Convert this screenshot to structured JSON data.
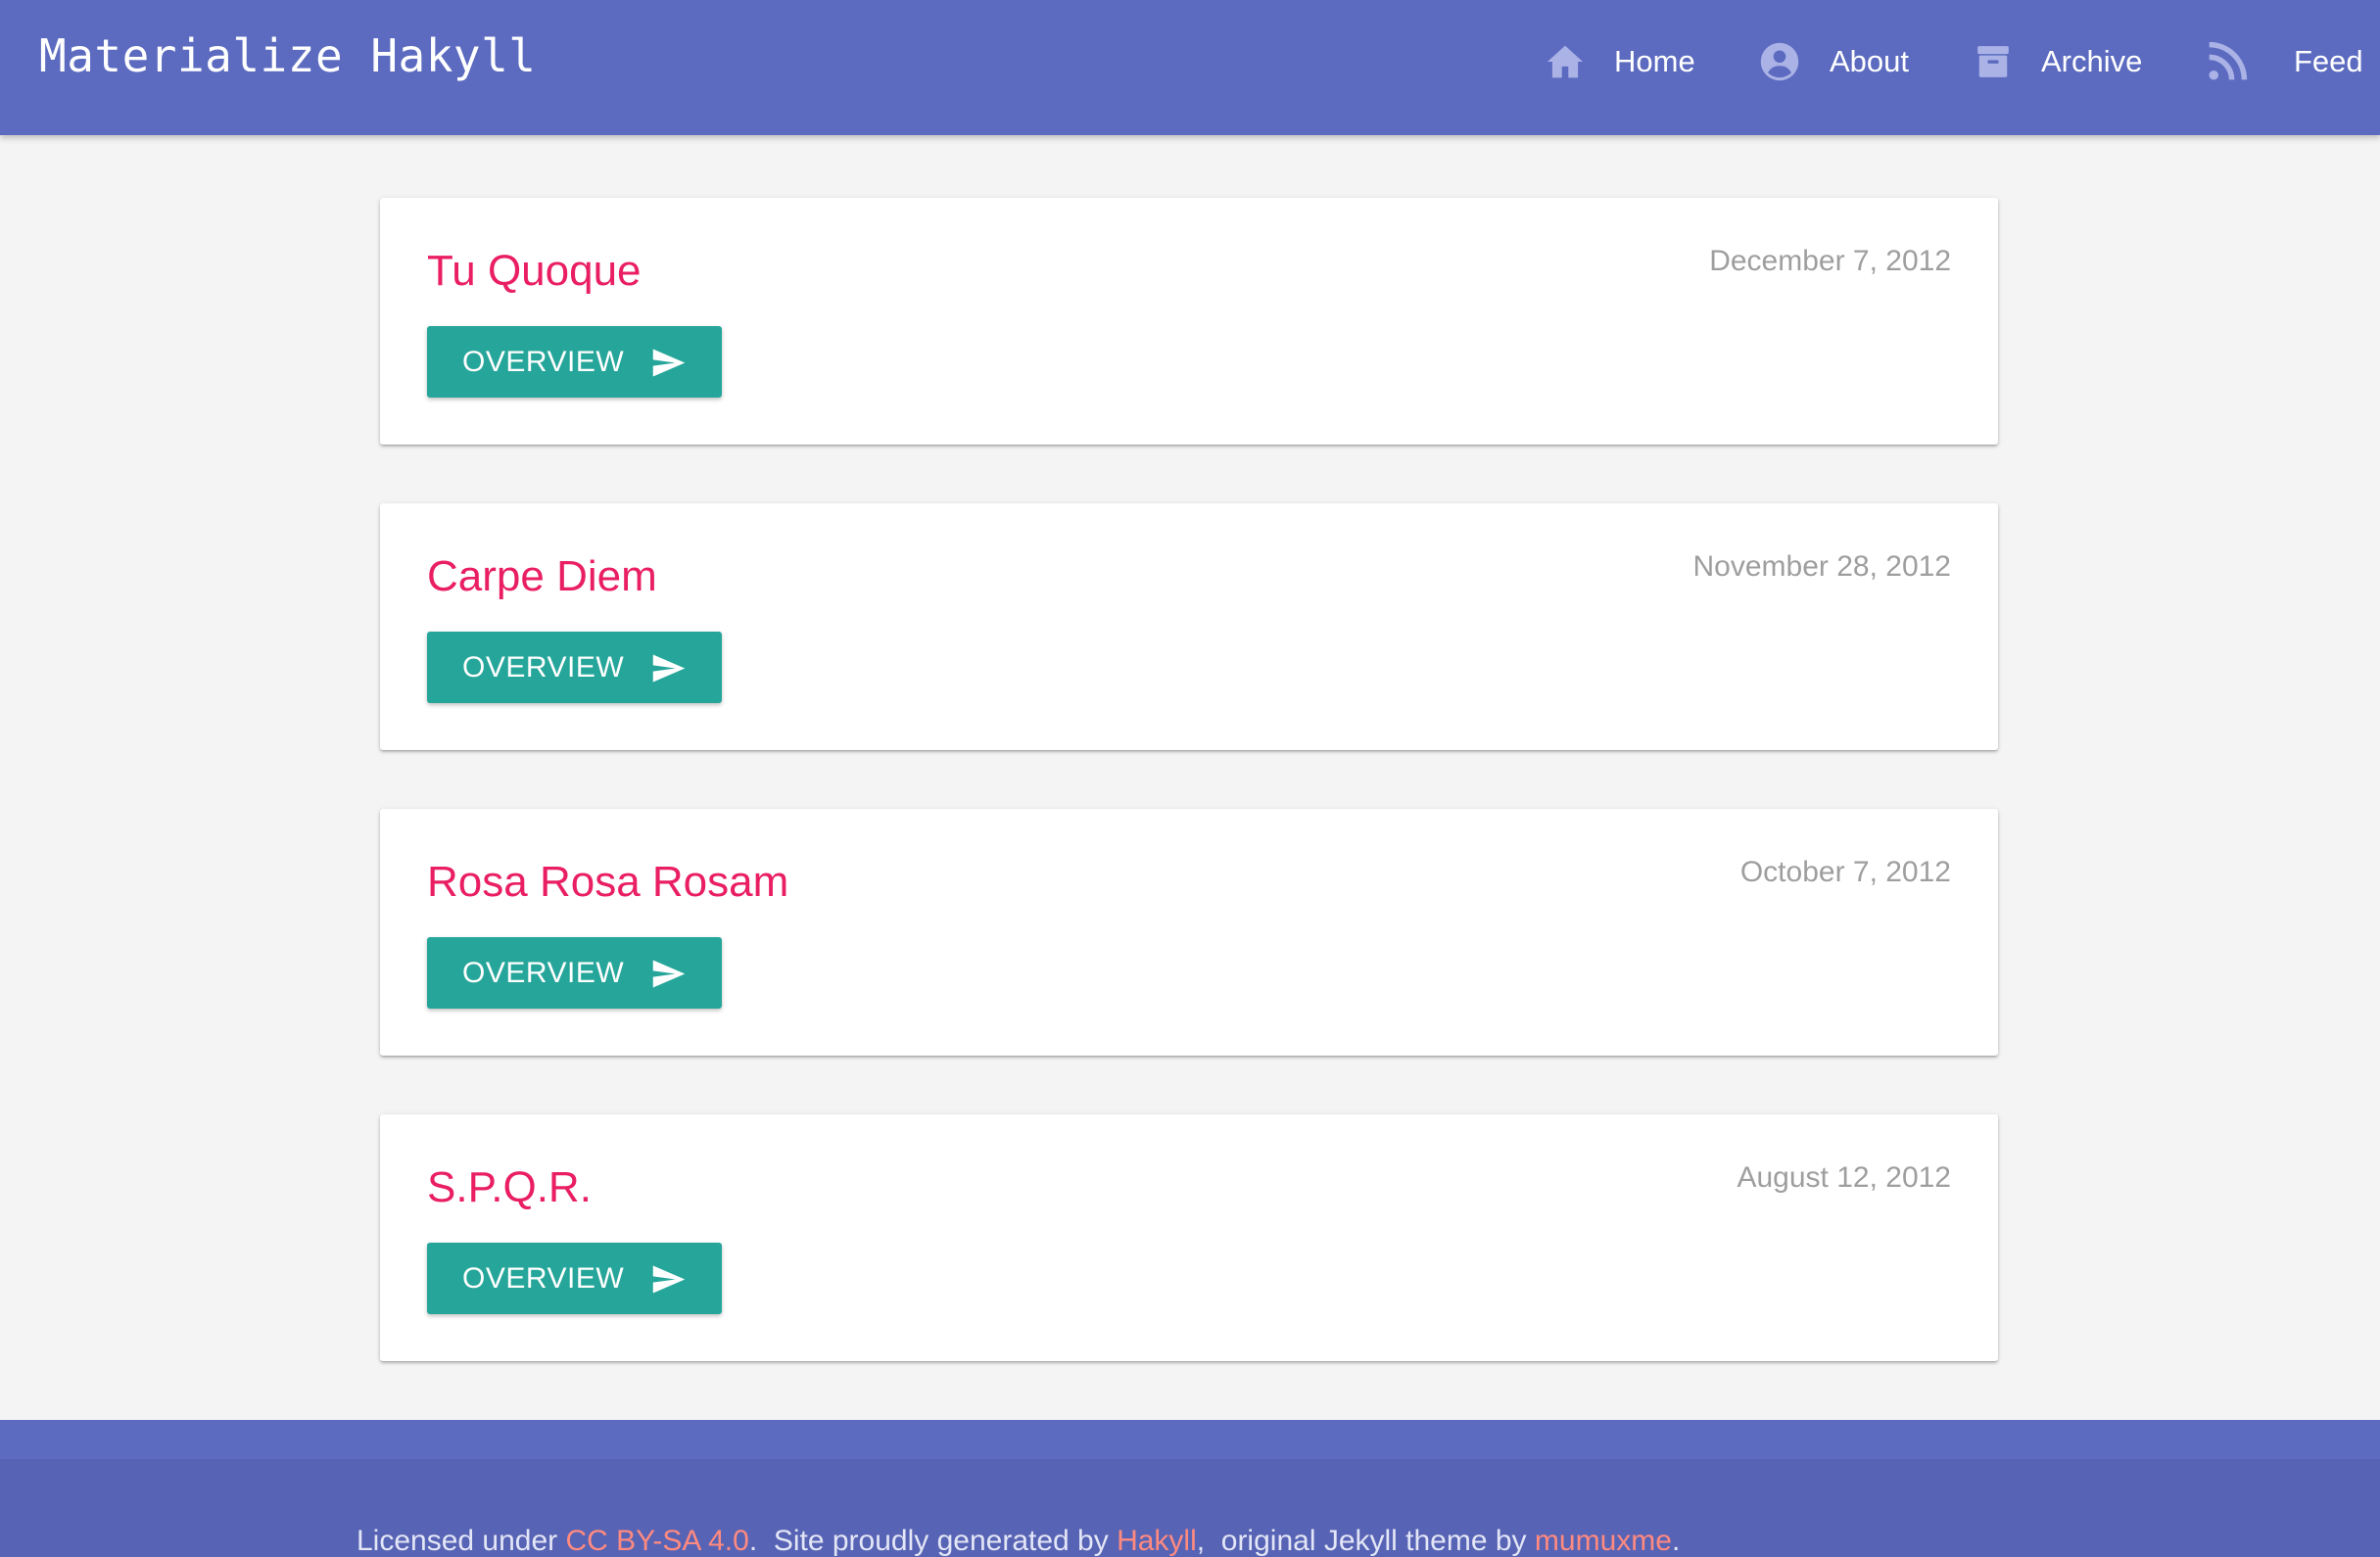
{
  "navbar": {
    "brand": "Materialize Hakyll",
    "items": [
      {
        "label": "Home",
        "icon": "home-icon"
      },
      {
        "label": "About",
        "icon": "account-circle-icon"
      },
      {
        "label": "Archive",
        "icon": "archive-icon"
      },
      {
        "label": "Feed",
        "icon": "rss-feed-icon"
      }
    ]
  },
  "posts": [
    {
      "title": "Tu Quoque",
      "date": "December 7, 2012",
      "button": "OVERVIEW"
    },
    {
      "title": "Carpe Diem",
      "date": "November 28, 2012",
      "button": "OVERVIEW"
    },
    {
      "title": "Rosa Rosa Rosam",
      "date": "October 7, 2012",
      "button": "OVERVIEW"
    },
    {
      "title": "S.P.Q.R.",
      "date": "August 12, 2012",
      "button": "OVERVIEW"
    }
  ],
  "footer": {
    "prefix": "Licensed under ",
    "license_link": "CC BY-SA 4.0",
    "middle": ".  Site proudly generated by ",
    "generator_link": "Hakyll",
    "middle2": ",  original Jekyll theme by ",
    "theme_author_link": "mumuxme",
    "suffix": "."
  },
  "colors": {
    "navbar": "#5c6bc0",
    "title_accent": "#e91e63",
    "button": "#26a69a",
    "footer_link": "#ff8a80",
    "background": "#f4f4f4"
  }
}
